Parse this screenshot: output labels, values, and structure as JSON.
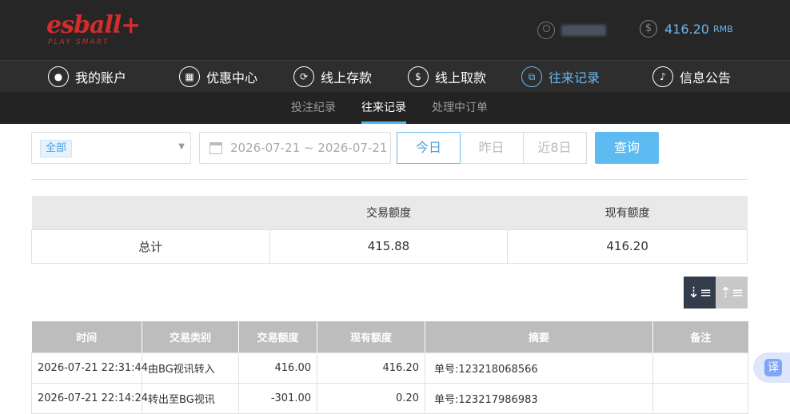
{
  "header": {
    "logo_text": "esball+",
    "logo_sub": "PLAY SMART",
    "balance": "416.20",
    "currency": "RMB",
    "icons": {
      "user": "user-icon",
      "balance": "dollar-icon"
    }
  },
  "main_nav": [
    {
      "label": "我的账户",
      "icon": "user-circle-icon"
    },
    {
      "label": "优惠中心",
      "icon": "gift-icon"
    },
    {
      "label": "线上存款",
      "icon": "deposit-icon"
    },
    {
      "label": "线上取款",
      "icon": "withdraw-icon"
    },
    {
      "label": "往来记录",
      "icon": "records-icon",
      "active": true
    },
    {
      "label": "信息公告",
      "icon": "bell-icon"
    }
  ],
  "sub_nav": [
    {
      "label": "投注纪录"
    },
    {
      "label": "往来记录",
      "active": true
    },
    {
      "label": "处理中订单"
    }
  ],
  "filter": {
    "type_selected": "全部",
    "date_range": "2026-07-21 ~ 2026-07-21",
    "quick_ranges": [
      "今日",
      "昨日",
      "近8日"
    ],
    "query_label": "查询"
  },
  "summary": {
    "headers": [
      "",
      "交易额度",
      "现有额度"
    ],
    "row": {
      "label": "总计",
      "trade_amount": "415.88",
      "current_balance": "416.20"
    }
  },
  "records": {
    "headers": [
      "时间",
      "交易类别",
      "交易额度",
      "现有额度",
      "摘要",
      "备注"
    ],
    "rows": [
      {
        "time": "2026-07-21 22:31:44",
        "type": "由BG视讯转入",
        "amount": "416.00",
        "balance": "416.20",
        "summary": "单号:123218068566",
        "note": ""
      },
      {
        "time": "2026-07-21 22:14:24",
        "type": "转出至BG视讯",
        "amount": "-301.00",
        "balance": "0.20",
        "summary": "单号:123217986983",
        "note": ""
      }
    ]
  },
  "translate_label": "译",
  "colors": {
    "accent": "#5ebbf2",
    "brand": "#d42b2b",
    "header_bg": "#262626"
  }
}
